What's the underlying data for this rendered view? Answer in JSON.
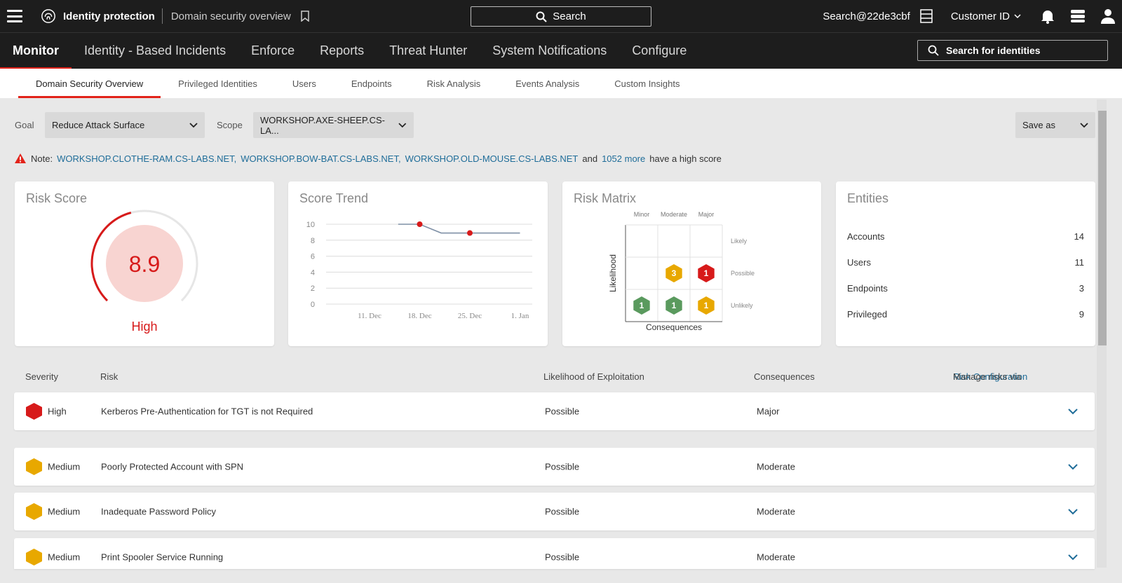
{
  "header": {
    "brand": "Identity protection",
    "crumb": "Domain security overview",
    "search_label": "Search",
    "user": "Search@22de3cbf",
    "customer": "Customer ID"
  },
  "mainnav": {
    "items": [
      "Monitor",
      "Identity - Based Incidents",
      "Enforce",
      "Reports",
      "Threat Hunter",
      "System Notifications",
      "Configure"
    ],
    "identity_search": "Search for identities"
  },
  "subtabs": [
    "Domain Security Overview",
    "Privileged Identities",
    "Users",
    "Endpoints",
    "Risk Analysis",
    "Events Analysis",
    "Custom Insights"
  ],
  "filters": {
    "goal_label": "Goal",
    "goal_value": "Reduce Attack Surface",
    "scope_label": "Scope",
    "scope_value": "WORKSHOP.AXE-SHEEP.CS-LA...",
    "save_as": "Save as"
  },
  "note": {
    "prefix": "Note:",
    "link1": "WORKSHOP.CLOTHE-RAM.CS-LABS.NET,",
    "link2": "WORKSHOP.BOW-BAT.CS-LABS.NET,",
    "link3": "WORKSHOP.OLD-MOUSE.CS-LABS.NET",
    "and": "and",
    "more": "1052 more",
    "suffix": "have a high score"
  },
  "risk_score": {
    "title": "Risk Score",
    "value": "8.9",
    "level": "High",
    "fraction": 0.89
  },
  "score_trend": {
    "title": "Score Trend",
    "chart_data": {
      "type": "line",
      "x_ticks": [
        "11. Dec",
        "18. Dec",
        "25. Dec",
        "1. Jan"
      ],
      "y_ticks": [
        "0",
        "2",
        "4",
        "6",
        "8",
        "10"
      ],
      "ylim": [
        0,
        10
      ],
      "points": [
        {
          "x": "15. Dec",
          "y": 10
        },
        {
          "x": "18. Dec",
          "y": 10
        },
        {
          "x": "21. Dec",
          "y": 8.9
        },
        {
          "x": "25. Dec",
          "y": 8.9
        },
        {
          "x": "1. Jan",
          "y": 8.9
        }
      ]
    }
  },
  "risk_matrix": {
    "title": "Risk Matrix",
    "columns": [
      "Minor",
      "Moderate",
      "Major"
    ],
    "rows": [
      "Likely",
      "Possible",
      "Unlikely"
    ],
    "xlabel": "Consequences",
    "ylabel": "Likelihood",
    "cells": [
      {
        "row": "Possible",
        "col": "Moderate",
        "count": "3",
        "color": "#e8a800"
      },
      {
        "row": "Possible",
        "col": "Major",
        "count": "1",
        "color": "#d71a1a"
      },
      {
        "row": "Unlikely",
        "col": "Minor",
        "count": "1",
        "color": "#5a9a5e"
      },
      {
        "row": "Unlikely",
        "col": "Moderate",
        "count": "1",
        "color": "#5a9a5e"
      },
      {
        "row": "Unlikely",
        "col": "Major",
        "count": "1",
        "color": "#e8a800"
      }
    ]
  },
  "entities": {
    "title": "Entities",
    "items": [
      {
        "label": "Accounts",
        "value": "14"
      },
      {
        "label": "Users",
        "value": "11"
      },
      {
        "label": "Endpoints",
        "value": "3"
      },
      {
        "label": "Privileged",
        "value": "9"
      }
    ]
  },
  "table": {
    "headers": {
      "severity": "Severity",
      "risk": "Risk",
      "likelihood": "Likelihood of Exploitation",
      "consequences": "Consequences",
      "manage": "Manage risks via",
      "manage_link": "Risk Configuration"
    },
    "rows": [
      {
        "severity": "High",
        "risk": "Kerberos Pre-Authentication for TGT is not Required",
        "likelihood": "Possible",
        "consequences": "Major",
        "color": "#d71a1a"
      },
      {
        "severity": "Medium",
        "risk": "Poorly Protected Account with SPN",
        "likelihood": "Possible",
        "consequences": "Moderate",
        "color": "#e8a800"
      },
      {
        "severity": "Medium",
        "risk": "Inadequate Password Policy",
        "likelihood": "Possible",
        "consequences": "Moderate",
        "color": "#e8a800"
      },
      {
        "severity": "Medium",
        "risk": "Print Spooler Service Running",
        "likelihood": "Possible",
        "consequences": "Moderate",
        "color": "#e8a800"
      }
    ]
  },
  "colors": {
    "accent": "#e2231a",
    "link": "#1f6d99",
    "high": "#d71a1a",
    "medium": "#e8a800",
    "low": "#5a9a5e"
  }
}
